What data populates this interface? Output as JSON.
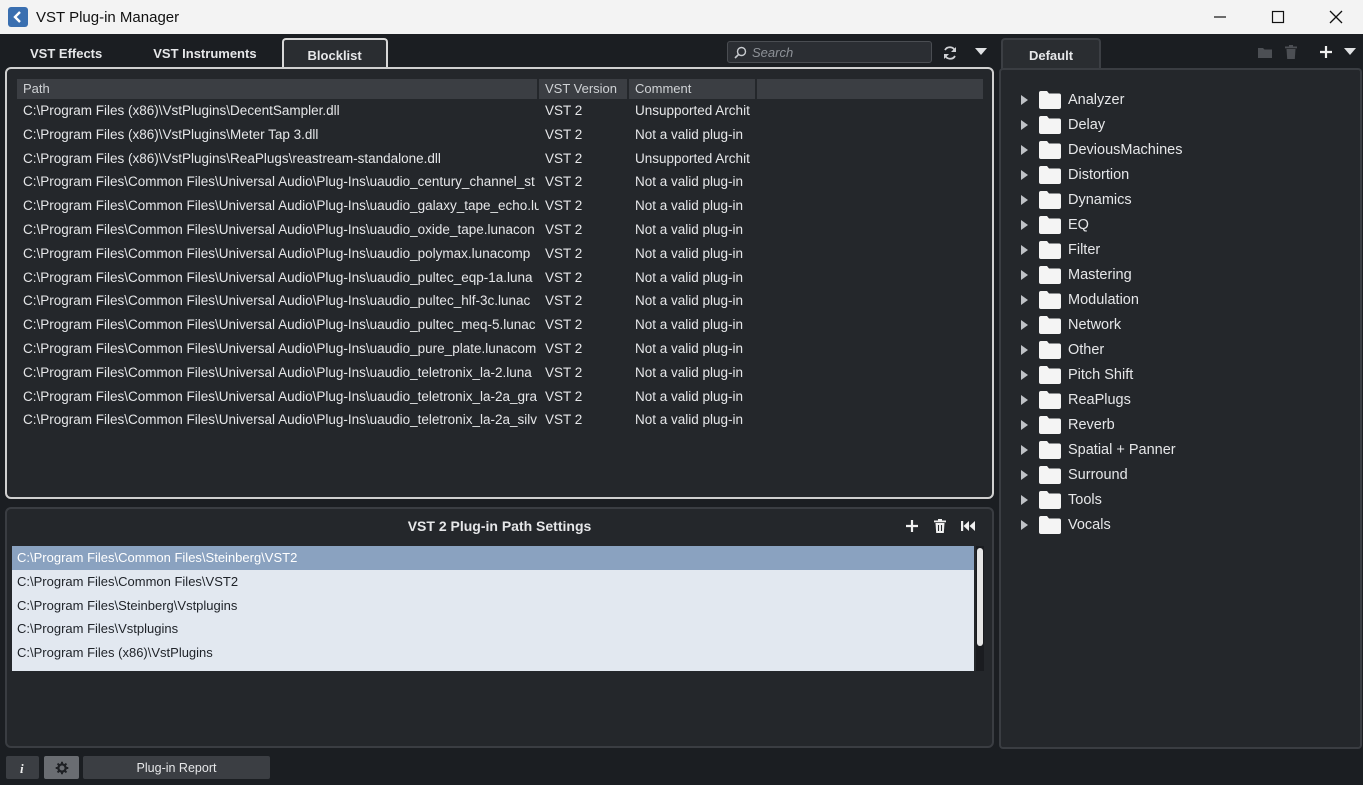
{
  "window": {
    "title": "VST Plug-in Manager"
  },
  "tabs": [
    {
      "label": "VST Effects"
    },
    {
      "label": "VST Instruments"
    },
    {
      "label": "Blocklist",
      "active": true
    }
  ],
  "search": {
    "placeholder": "Search",
    "value": ""
  },
  "blocklist": {
    "columns": [
      "Path",
      "VST Version",
      "Comment",
      ""
    ],
    "rows": [
      {
        "path": "C:\\Program Files (x86)\\VstPlugins\\DecentSampler.dll",
        "version": "VST 2",
        "comment": "Unsupported Archit"
      },
      {
        "path": "C:\\Program Files (x86)\\VstPlugins\\Meter Tap 3.dll",
        "version": "VST 2",
        "comment": "Not a valid plug-in"
      },
      {
        "path": "C:\\Program Files (x86)\\VstPlugins\\ReaPlugs\\reastream-standalone.dll",
        "version": "VST 2",
        "comment": "Unsupported Archit"
      },
      {
        "path": "C:\\Program Files\\Common Files\\Universal Audio\\Plug-Ins\\uaudio_century_channel_st",
        "version": "VST 2",
        "comment": "Not a valid plug-in"
      },
      {
        "path": "C:\\Program Files\\Common Files\\Universal Audio\\Plug-Ins\\uaudio_galaxy_tape_echo.lu",
        "version": "VST 2",
        "comment": "Not a valid plug-in"
      },
      {
        "path": "C:\\Program Files\\Common Files\\Universal Audio\\Plug-Ins\\uaudio_oxide_tape.lunacon",
        "version": "VST 2",
        "comment": "Not a valid plug-in"
      },
      {
        "path": "C:\\Program Files\\Common Files\\Universal Audio\\Plug-Ins\\uaudio_polymax.lunacomp",
        "version": "VST 2",
        "comment": "Not a valid plug-in"
      },
      {
        "path": "C:\\Program Files\\Common Files\\Universal Audio\\Plug-Ins\\uaudio_pultec_eqp-1a.luna",
        "version": "VST 2",
        "comment": "Not a valid plug-in"
      },
      {
        "path": "C:\\Program Files\\Common Files\\Universal Audio\\Plug-Ins\\uaudio_pultec_hlf-3c.lunac",
        "version": "VST 2",
        "comment": "Not a valid plug-in"
      },
      {
        "path": "C:\\Program Files\\Common Files\\Universal Audio\\Plug-Ins\\uaudio_pultec_meq-5.lunac",
        "version": "VST 2",
        "comment": "Not a valid plug-in"
      },
      {
        "path": "C:\\Program Files\\Common Files\\Universal Audio\\Plug-Ins\\uaudio_pure_plate.lunacom",
        "version": "VST 2",
        "comment": "Not a valid plug-in"
      },
      {
        "path": "C:\\Program Files\\Common Files\\Universal Audio\\Plug-Ins\\uaudio_teletronix_la-2.luna",
        "version": "VST 2",
        "comment": "Not a valid plug-in"
      },
      {
        "path": "C:\\Program Files\\Common Files\\Universal Audio\\Plug-Ins\\uaudio_teletronix_la-2a_gra",
        "version": "VST 2",
        "comment": "Not a valid plug-in"
      },
      {
        "path": "C:\\Program Files\\Common Files\\Universal Audio\\Plug-Ins\\uaudio_teletronix_la-2a_silv",
        "version": "VST 2",
        "comment": "Not a valid plug-in"
      }
    ]
  },
  "path_settings": {
    "title": "VST 2 Plug-in Path Settings",
    "paths": [
      {
        "label": "C:\\Program Files\\Common Files\\Steinberg\\VST2",
        "selected": true
      },
      {
        "label": "C:\\Program Files\\Common Files\\VST2"
      },
      {
        "label": "C:\\Program Files\\Steinberg\\Vstplugins"
      },
      {
        "label": "C:\\Program Files\\Vstplugins"
      },
      {
        "label": "C:\\Program Files (x86)\\VstPlugins"
      }
    ]
  },
  "collections": {
    "tab_label": "Default",
    "folders": [
      "Analyzer",
      "Delay",
      "DeviousMachines",
      "Distortion",
      "Dynamics",
      "EQ",
      "Filter",
      "Mastering",
      "Modulation",
      "Network",
      "Other",
      "Pitch Shift",
      "ReaPlugs",
      "Reverb",
      "Spatial + Panner",
      "Surround",
      "Tools",
      "Vocals"
    ]
  },
  "footer": {
    "report_label": "Plug-in Report"
  }
}
